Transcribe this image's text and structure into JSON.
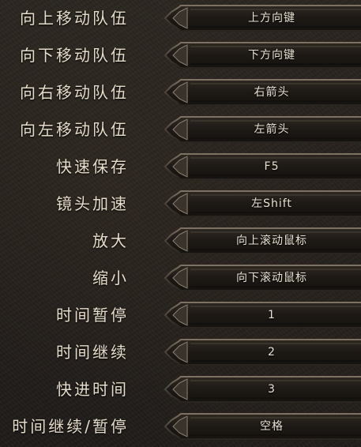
{
  "keybindings": [
    {
      "action": "向上移动队伍",
      "key": "上方向键"
    },
    {
      "action": "向下移动队伍",
      "key": "下方向键"
    },
    {
      "action": "向右移动队伍",
      "key": "右箭头"
    },
    {
      "action": "向左移动队伍",
      "key": "左箭头"
    },
    {
      "action": "快速保存",
      "key": "F5"
    },
    {
      "action": "镜头加速",
      "key": "左Shift"
    },
    {
      "action": "放大",
      "key": "向上滚动鼠标"
    },
    {
      "action": "缩小",
      "key": "向下滚动鼠标"
    },
    {
      "action": "时间暂停",
      "key": "1"
    },
    {
      "action": "时间继续",
      "key": "2"
    },
    {
      "action": "快进时间",
      "key": "3"
    },
    {
      "action": "时间继续/暂停",
      "key": "空格"
    }
  ]
}
